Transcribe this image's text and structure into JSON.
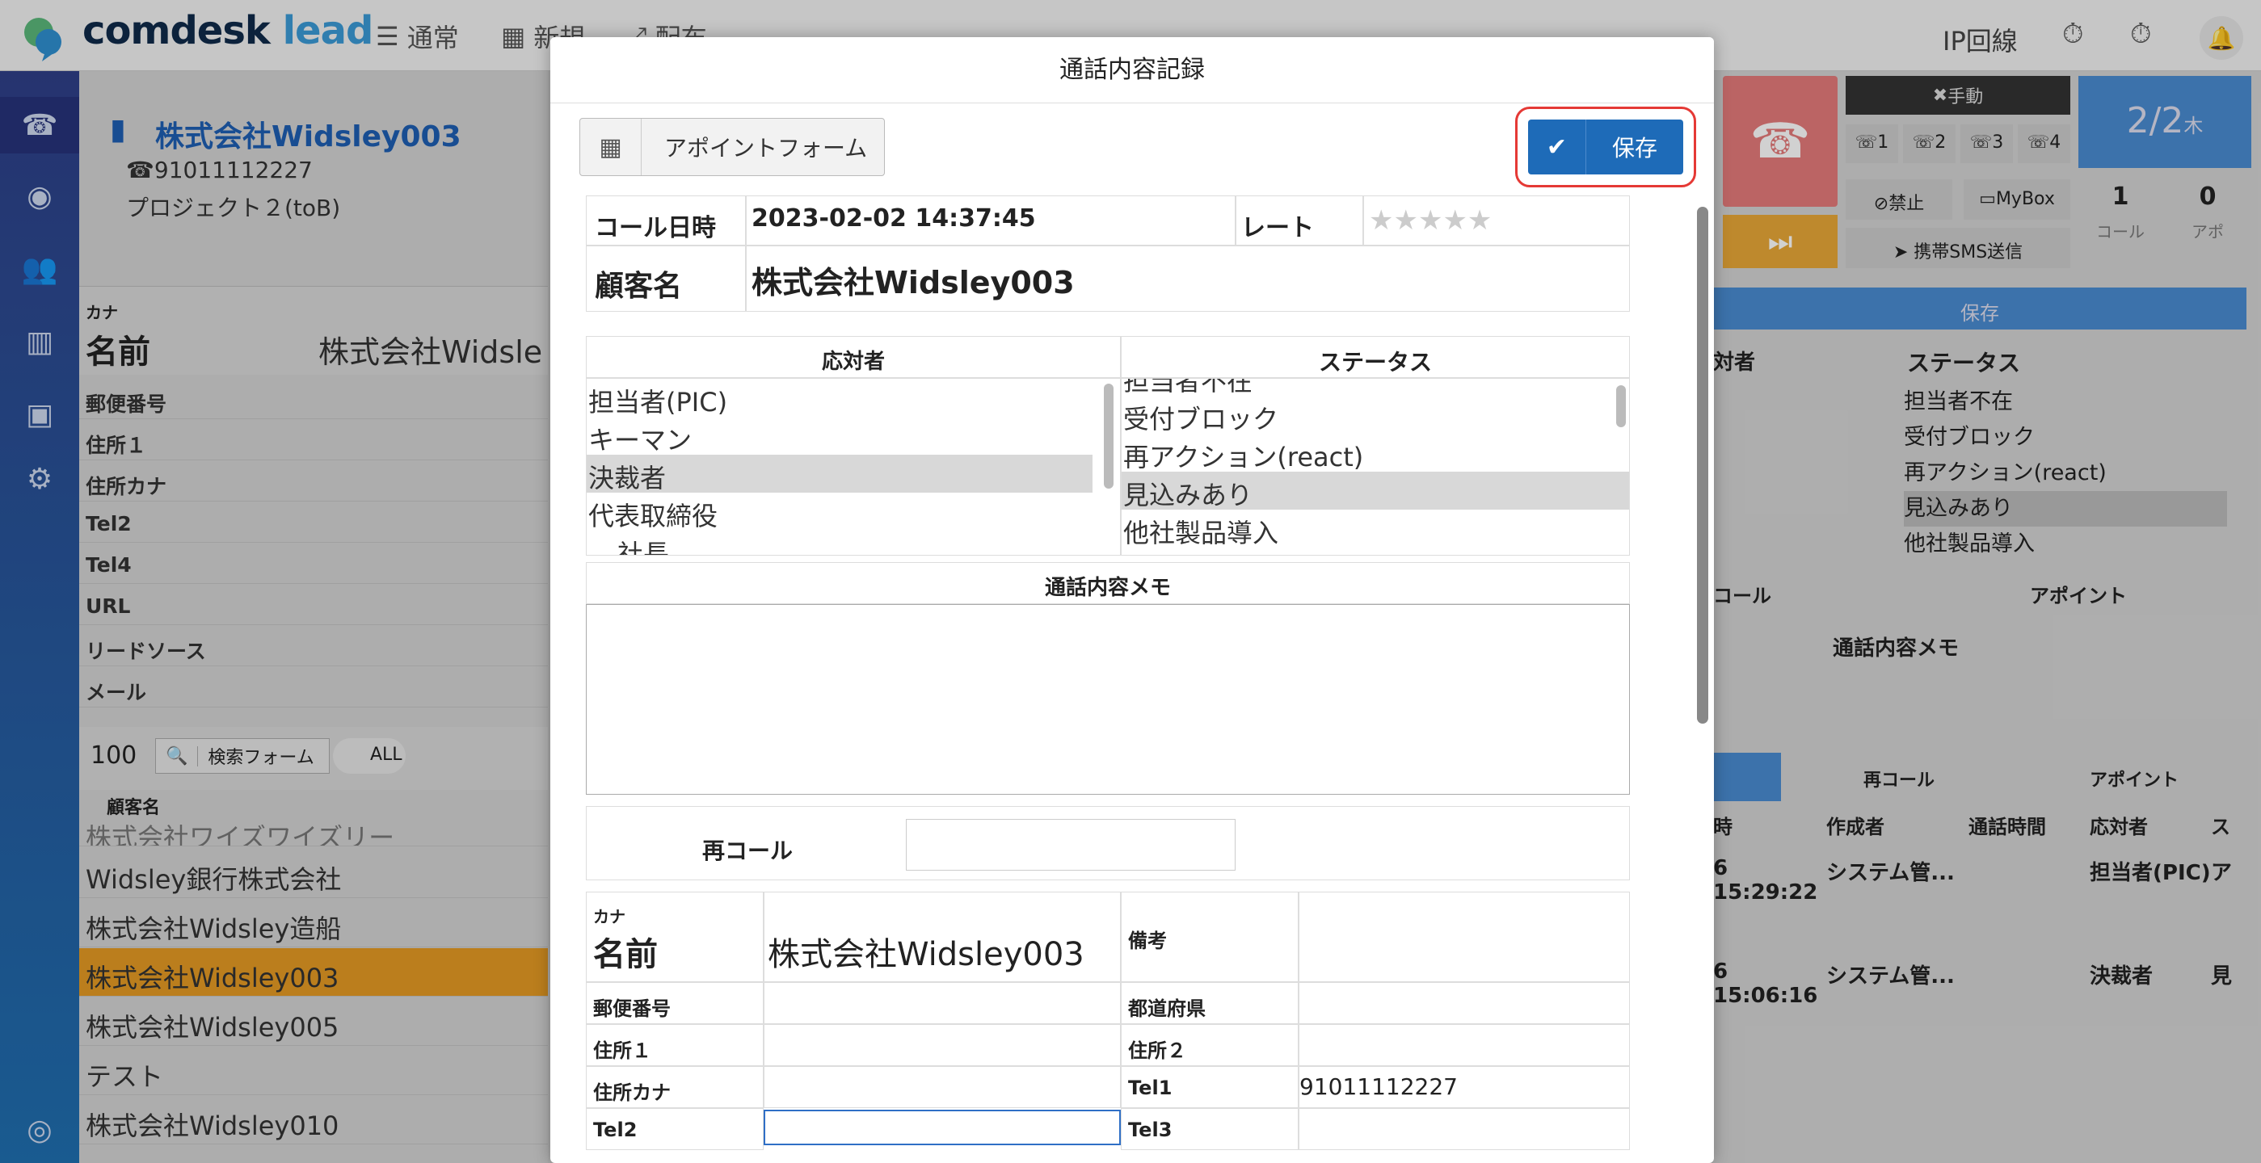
{
  "app": {
    "brand_main": "comdesk",
    "brand_accent": "lead",
    "nav": [
      "通常",
      "新規",
      "配布"
    ],
    "ip_line": "IP回線"
  },
  "left": {
    "company": "株式会社Widsley003",
    "phone": "91011112227",
    "project": "プロジェクト２(toB)",
    "kana_label": "カナ",
    "name_label": "名前",
    "name_value": "株式会社Widsle",
    "fields": [
      "郵便番号",
      "住所１",
      "住所カナ",
      "Tel2",
      "Tel4",
      "URL",
      "リードソース",
      "メール"
    ],
    "page_size": "100",
    "search_form": "検索フォーム",
    "all": "ALL",
    "col_customer": "顧客名",
    "list": [
      "株式会社ワイズワイズリー",
      "Widsley銀行株式会社",
      "株式会社Widsley造船",
      "株式会社Widsley003",
      "株式会社Widsley005",
      "テスト",
      "株式会社Widsley010"
    ]
  },
  "right": {
    "manual": "手動",
    "date": "2/2",
    "weekday": "木",
    "lines": [
      "1",
      "2",
      "3",
      "4"
    ],
    "ban": "禁止",
    "mybox": "MyBox",
    "sms": "携帯SMS送信",
    "call_count": "1",
    "call_label": "コール",
    "appo_count": "0",
    "appo_label": "アポ",
    "save": "保存",
    "respondent_partial": "対者",
    "status": "ステータス",
    "status_items": [
      "担当者不在",
      "受付ブロック",
      "再アクション(react)",
      "見込みあり",
      "他社製品導入"
    ],
    "recall_partial": "コール",
    "appoint": "アポイント",
    "memo": "通話内容メモ",
    "recall": "再コール",
    "appoint2": "アポイント",
    "history_headers": [
      "時",
      "作成者",
      "通話時間",
      "応対者",
      "ス"
    ],
    "history": [
      [
        "6 15:29:22",
        "システム管...",
        "",
        "担当者(PIC)",
        "ア"
      ],
      [
        "6 15:06:16",
        "システム管...",
        "",
        "決裁者",
        "見"
      ]
    ]
  },
  "modal": {
    "title": "通話内容記録",
    "appointment_form": "アポイントフォーム",
    "save": "保存",
    "call_datetime_label": "コール日時",
    "call_datetime": "2023-02-02 14:37:45",
    "rate_label": "レート",
    "stars": "★★★★★",
    "customer_label": "顧客名",
    "customer": "株式会社Widsley003",
    "respondent_header": "応対者",
    "status_header": "ステータス",
    "respondents": [
      "担当者(PIC)",
      "キーマン",
      "決裁者",
      "代表取締役",
      "社長"
    ],
    "statuses": [
      "担当者不在",
      "受付ブロック",
      "再アクション(react)",
      "見込みあり",
      "他社製品導入"
    ],
    "memo_header": "通話内容メモ",
    "recall_label": "再コール",
    "kana_label": "カナ",
    "name_label": "名前",
    "name_value": "株式会社Widsley003",
    "remarks_label": "備考",
    "postal_label": "郵便番号",
    "prefecture_label": "都道府県",
    "addr1_label": "住所１",
    "addr2_label": "住所２",
    "addr_kana_label": "住所カナ",
    "tel1_label": "Tel1",
    "tel1_value": "91011112227",
    "tel2_label": "Tel2",
    "tel3_label": "Tel3"
  },
  "colors": {
    "accent": "#1e6bb8",
    "highlight": "#e53935",
    "selected_row": "#e49a24",
    "sidebar": "#2f3f88"
  }
}
